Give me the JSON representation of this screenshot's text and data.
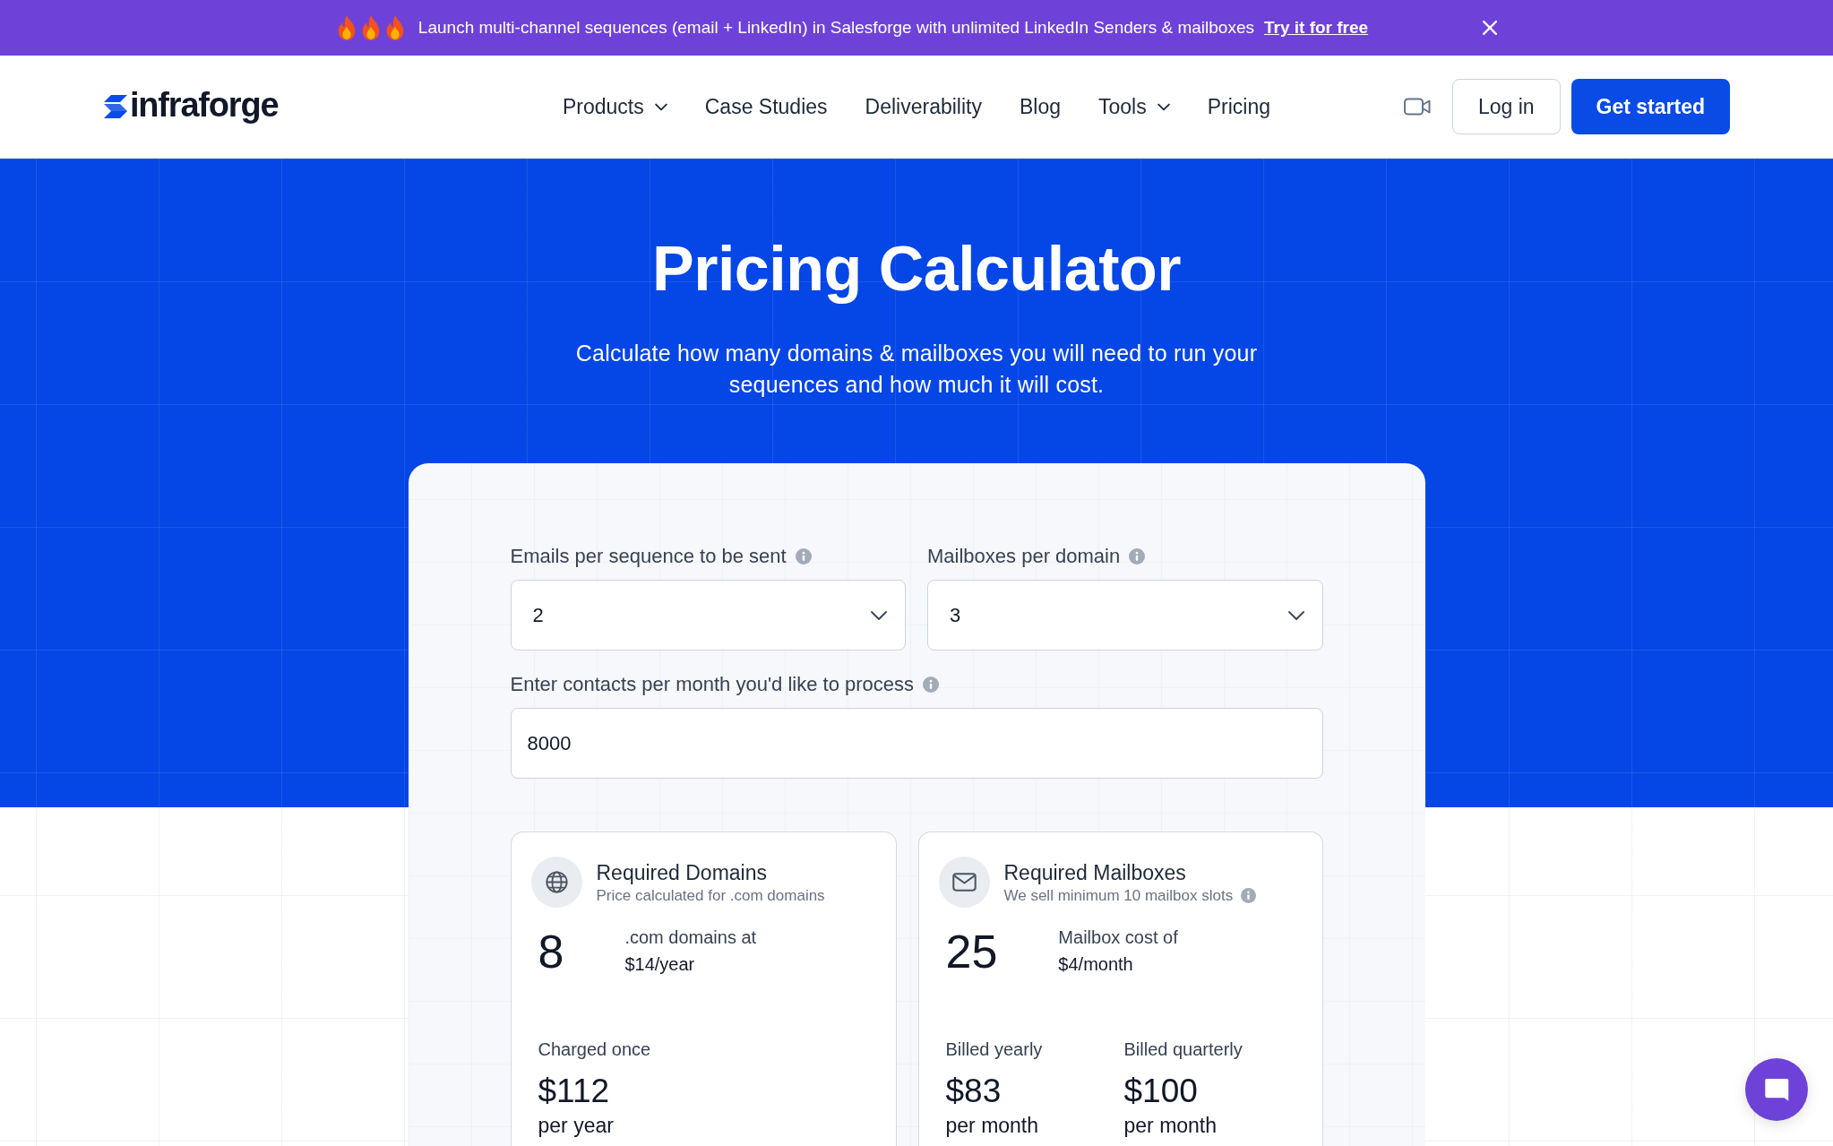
{
  "announcement": {
    "text": "Launch multi-channel sequences (email + LinkedIn) in Salesforge with unlimited LinkedIn Senders & mailboxes",
    "link": "Try it for free"
  },
  "header": {
    "logo": "infraforge",
    "nav": [
      {
        "label": "Products",
        "dropdown": true
      },
      {
        "label": "Case Studies",
        "dropdown": false
      },
      {
        "label": "Deliverability",
        "dropdown": false
      },
      {
        "label": "Blog",
        "dropdown": false
      },
      {
        "label": "Tools",
        "dropdown": true
      },
      {
        "label": "Pricing",
        "dropdown": false
      }
    ],
    "login": "Log in",
    "cta": "Get started"
  },
  "hero": {
    "title": "Pricing Calculator",
    "subtitle": "Calculate how many domains & mailboxes you will need to run your sequences and how much it will cost."
  },
  "calculator": {
    "fields": [
      {
        "kind": "select",
        "label": "Emails per sequence to be sent",
        "info": true,
        "value": "2"
      },
      {
        "kind": "select",
        "label": "Mailboxes per domain",
        "info": true,
        "value": "3"
      },
      {
        "kind": "input",
        "label": "Enter contacts per month you'd like to process",
        "info": true,
        "value": "8000"
      }
    ],
    "results": [
      {
        "title": "Required Domains",
        "subtitle": "Price calculated for .com domains",
        "info": false,
        "count": "8",
        "rate_label": ".com domains at",
        "rate": "$14/year",
        "prices": [
          {
            "label": "Charged once",
            "amount": "$112",
            "period": "per year"
          }
        ]
      },
      {
        "title": "Required Mailboxes",
        "subtitle": "We sell minimum 10 mailbox slots",
        "info": true,
        "count": "25",
        "rate_label": "Mailbox cost of",
        "rate": "$4/month",
        "prices": [
          {
            "label": "Billed yearly",
            "amount": "$83",
            "period": "per month"
          },
          {
            "label": "Billed quarterly",
            "amount": "$100",
            "period": "per month"
          }
        ]
      }
    ]
  }
}
